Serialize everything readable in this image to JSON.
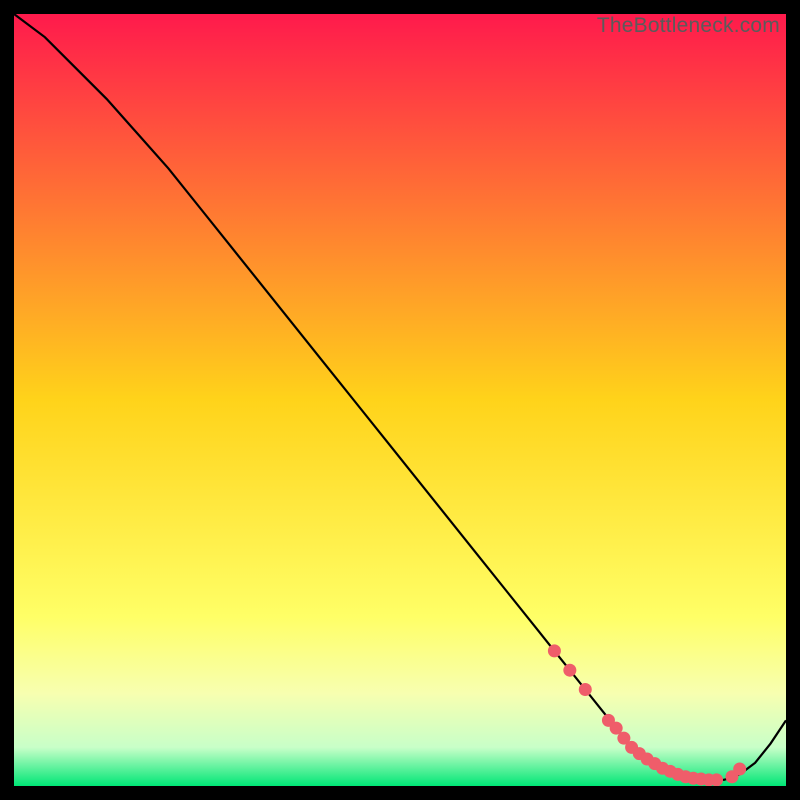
{
  "watermark": "TheBottleneck.com",
  "chart_data": {
    "type": "line",
    "title": "",
    "xlabel": "",
    "ylabel": "",
    "xlim": [
      0,
      100
    ],
    "ylim": [
      0,
      100
    ],
    "grid": false,
    "legend": false,
    "background_gradient": {
      "stops": [
        {
          "offset": 0.0,
          "color": "#ff1a4c"
        },
        {
          "offset": 0.5,
          "color": "#ffd31a"
        },
        {
          "offset": 0.78,
          "color": "#ffff66"
        },
        {
          "offset": 0.88,
          "color": "#f7ffb0"
        },
        {
          "offset": 0.95,
          "color": "#c8ffc8"
        },
        {
          "offset": 1.0,
          "color": "#00e676"
        }
      ]
    },
    "series": [
      {
        "name": "bottleneck-curve",
        "color": "#000000",
        "x": [
          0,
          4,
          8,
          12,
          16,
          20,
          24,
          28,
          32,
          36,
          40,
          44,
          48,
          52,
          56,
          60,
          64,
          68,
          70,
          72,
          74,
          76,
          78,
          80,
          82,
          84,
          86,
          88,
          90,
          92,
          94,
          96,
          98,
          100
        ],
        "y": [
          100,
          97,
          93,
          89,
          84.5,
          80,
          75,
          70,
          65,
          60,
          55,
          50,
          45,
          40,
          35,
          30,
          25,
          20,
          17.5,
          15,
          12.5,
          10,
          7.5,
          5,
          3.5,
          2.3,
          1.5,
          1.0,
          0.8,
          0.8,
          1.5,
          3.0,
          5.5,
          8.5
        ]
      }
    ],
    "markers": {
      "name": "recommended-range-dots",
      "color": "#ef5d6a",
      "x": [
        70,
        72,
        74,
        77,
        78,
        79,
        80,
        81,
        82,
        83,
        84,
        85,
        86,
        87,
        88,
        89,
        90,
        91,
        93,
        94
      ],
      "y": [
        17.5,
        15,
        12.5,
        8.5,
        7.5,
        6.2,
        5.0,
        4.2,
        3.5,
        2.9,
        2.3,
        1.9,
        1.5,
        1.2,
        1.0,
        0.9,
        0.8,
        0.8,
        1.2,
        2.2
      ]
    }
  }
}
